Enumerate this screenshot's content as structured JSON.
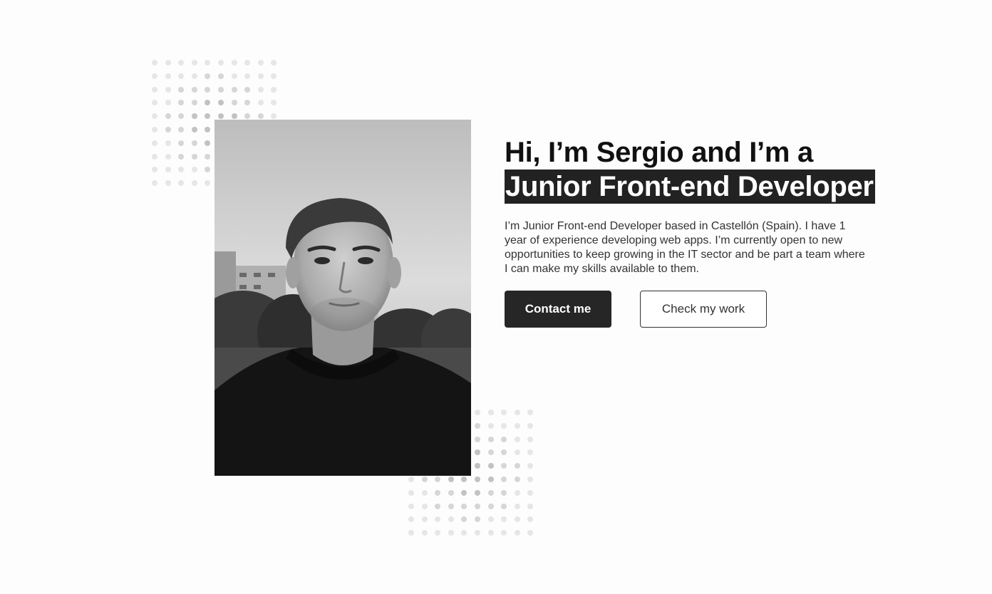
{
  "hero": {
    "greeting": "Hi, I’m Sergio and I’m a",
    "role": "Junior Front-end Developer",
    "bio": "I’m Junior Front-end Developer based in Castellón (Spain). I have 1 year of experience developing web apps. I’m currently open to new opportunities to keep growing in the IT sector and be part a team where I can make my skills available to them.",
    "contact_label": "Contact me",
    "work_label": "Check my work"
  },
  "colors": {
    "background": "#fdfdfd",
    "primary_button": "#262626",
    "highlight": "#222222",
    "dots": "#e6e6e6"
  }
}
